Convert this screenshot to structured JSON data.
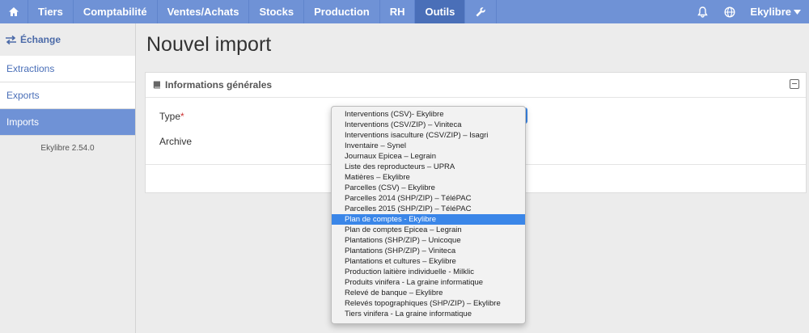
{
  "nav": {
    "items": [
      {
        "label": "Tiers"
      },
      {
        "label": "Comptabilité"
      },
      {
        "label": "Ventes/Achats"
      },
      {
        "label": "Stocks"
      },
      {
        "label": "Production"
      },
      {
        "label": "RH"
      },
      {
        "label": "Outils",
        "active": true
      }
    ],
    "user": "Ekylibre",
    "icons": [
      "home-icon",
      "wrench-icon",
      "bell-icon",
      "globe-icon",
      "caret-down-icon"
    ]
  },
  "sidebar": {
    "header": "Échange",
    "items": [
      {
        "label": "Extractions"
      },
      {
        "label": "Exports"
      },
      {
        "label": "Imports",
        "active": true
      }
    ],
    "version": "Ekylibre 2.54.0"
  },
  "main": {
    "title": "Nouvel import",
    "panel": {
      "title": "Informations générales",
      "type_label": "Type",
      "required_mark": "*",
      "archive_label": "Archive"
    }
  },
  "dropdown": {
    "selected_index": 10,
    "options": [
      "Interventions (CSV)- Ekylibre",
      "Interventions (CSV/ZIP) – Viniteca",
      "Interventions isaculture (CSV/ZIP) – Isagri",
      "Inventaire – Synel",
      "Journaux Epicea – Legrain",
      "Liste des reproducteurs – UPRA",
      "Matières – Ekylibre",
      "Parcelles (CSV) – Ekylibre",
      "Parcelles 2014 (SHP/ZIP) – TéléPAC",
      "Parcelles 2015 (SHP/ZIP) – TéléPAC",
      "Plan de comptes - Ekylibre",
      "Plan de comptes Epicea – Legrain",
      "Plantations (SHP/ZIP) – Unicoque",
      "Plantations (SHP/ZIP) – Viniteca",
      "Plantations et cultures – Ekylibre",
      "Production laitière individuelle - Milklic",
      "Produits vinifera - La graine informatique",
      "Relevé de banque – Ekylibre",
      "Relevés topographiques (SHP/ZIP) – Ekylibre",
      "Tiers vinifera - La graine informatique"
    ]
  },
  "colors": {
    "navbar": "#6f92d6",
    "active": "#4a6fb8",
    "highlight": "#3a86e8"
  }
}
